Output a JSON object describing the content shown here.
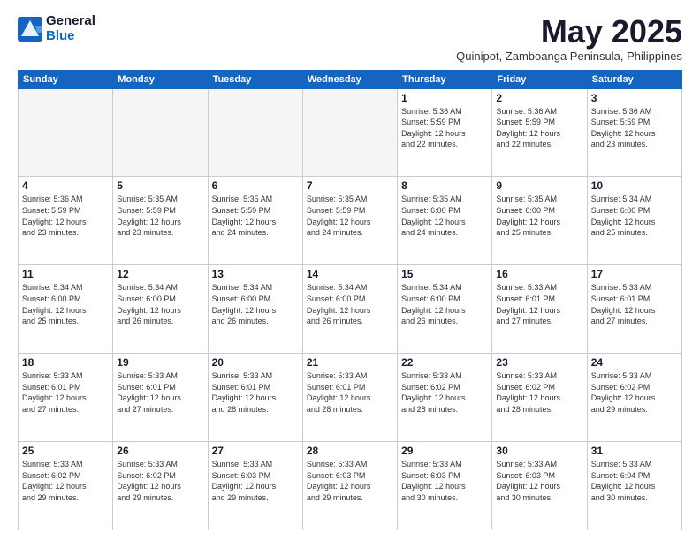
{
  "logo": {
    "general": "General",
    "blue": "Blue"
  },
  "title": "May 2025",
  "subtitle": "Quinipot, Zamboanga Peninsula, Philippines",
  "days_of_week": [
    "Sunday",
    "Monday",
    "Tuesday",
    "Wednesday",
    "Thursday",
    "Friday",
    "Saturday"
  ],
  "weeks": [
    [
      {
        "day": "",
        "info": ""
      },
      {
        "day": "",
        "info": ""
      },
      {
        "day": "",
        "info": ""
      },
      {
        "day": "",
        "info": ""
      },
      {
        "day": "1",
        "info": "Sunrise: 5:36 AM\nSunset: 5:59 PM\nDaylight: 12 hours\nand 22 minutes."
      },
      {
        "day": "2",
        "info": "Sunrise: 5:36 AM\nSunset: 5:59 PM\nDaylight: 12 hours\nand 22 minutes."
      },
      {
        "day": "3",
        "info": "Sunrise: 5:36 AM\nSunset: 5:59 PM\nDaylight: 12 hours\nand 23 minutes."
      }
    ],
    [
      {
        "day": "4",
        "info": "Sunrise: 5:36 AM\nSunset: 5:59 PM\nDaylight: 12 hours\nand 23 minutes."
      },
      {
        "day": "5",
        "info": "Sunrise: 5:35 AM\nSunset: 5:59 PM\nDaylight: 12 hours\nand 23 minutes."
      },
      {
        "day": "6",
        "info": "Sunrise: 5:35 AM\nSunset: 5:59 PM\nDaylight: 12 hours\nand 24 minutes."
      },
      {
        "day": "7",
        "info": "Sunrise: 5:35 AM\nSunset: 5:59 PM\nDaylight: 12 hours\nand 24 minutes."
      },
      {
        "day": "8",
        "info": "Sunrise: 5:35 AM\nSunset: 6:00 PM\nDaylight: 12 hours\nand 24 minutes."
      },
      {
        "day": "9",
        "info": "Sunrise: 5:35 AM\nSunset: 6:00 PM\nDaylight: 12 hours\nand 25 minutes."
      },
      {
        "day": "10",
        "info": "Sunrise: 5:34 AM\nSunset: 6:00 PM\nDaylight: 12 hours\nand 25 minutes."
      }
    ],
    [
      {
        "day": "11",
        "info": "Sunrise: 5:34 AM\nSunset: 6:00 PM\nDaylight: 12 hours\nand 25 minutes."
      },
      {
        "day": "12",
        "info": "Sunrise: 5:34 AM\nSunset: 6:00 PM\nDaylight: 12 hours\nand 26 minutes."
      },
      {
        "day": "13",
        "info": "Sunrise: 5:34 AM\nSunset: 6:00 PM\nDaylight: 12 hours\nand 26 minutes."
      },
      {
        "day": "14",
        "info": "Sunrise: 5:34 AM\nSunset: 6:00 PM\nDaylight: 12 hours\nand 26 minutes."
      },
      {
        "day": "15",
        "info": "Sunrise: 5:34 AM\nSunset: 6:00 PM\nDaylight: 12 hours\nand 26 minutes."
      },
      {
        "day": "16",
        "info": "Sunrise: 5:33 AM\nSunset: 6:01 PM\nDaylight: 12 hours\nand 27 minutes."
      },
      {
        "day": "17",
        "info": "Sunrise: 5:33 AM\nSunset: 6:01 PM\nDaylight: 12 hours\nand 27 minutes."
      }
    ],
    [
      {
        "day": "18",
        "info": "Sunrise: 5:33 AM\nSunset: 6:01 PM\nDaylight: 12 hours\nand 27 minutes."
      },
      {
        "day": "19",
        "info": "Sunrise: 5:33 AM\nSunset: 6:01 PM\nDaylight: 12 hours\nand 27 minutes."
      },
      {
        "day": "20",
        "info": "Sunrise: 5:33 AM\nSunset: 6:01 PM\nDaylight: 12 hours\nand 28 minutes."
      },
      {
        "day": "21",
        "info": "Sunrise: 5:33 AM\nSunset: 6:01 PM\nDaylight: 12 hours\nand 28 minutes."
      },
      {
        "day": "22",
        "info": "Sunrise: 5:33 AM\nSunset: 6:02 PM\nDaylight: 12 hours\nand 28 minutes."
      },
      {
        "day": "23",
        "info": "Sunrise: 5:33 AM\nSunset: 6:02 PM\nDaylight: 12 hours\nand 28 minutes."
      },
      {
        "day": "24",
        "info": "Sunrise: 5:33 AM\nSunset: 6:02 PM\nDaylight: 12 hours\nand 29 minutes."
      }
    ],
    [
      {
        "day": "25",
        "info": "Sunrise: 5:33 AM\nSunset: 6:02 PM\nDaylight: 12 hours\nand 29 minutes."
      },
      {
        "day": "26",
        "info": "Sunrise: 5:33 AM\nSunset: 6:02 PM\nDaylight: 12 hours\nand 29 minutes."
      },
      {
        "day": "27",
        "info": "Sunrise: 5:33 AM\nSunset: 6:03 PM\nDaylight: 12 hours\nand 29 minutes."
      },
      {
        "day": "28",
        "info": "Sunrise: 5:33 AM\nSunset: 6:03 PM\nDaylight: 12 hours\nand 29 minutes."
      },
      {
        "day": "29",
        "info": "Sunrise: 5:33 AM\nSunset: 6:03 PM\nDaylight: 12 hours\nand 30 minutes."
      },
      {
        "day": "30",
        "info": "Sunrise: 5:33 AM\nSunset: 6:03 PM\nDaylight: 12 hours\nand 30 minutes."
      },
      {
        "day": "31",
        "info": "Sunrise: 5:33 AM\nSunset: 6:04 PM\nDaylight: 12 hours\nand 30 minutes."
      }
    ]
  ]
}
